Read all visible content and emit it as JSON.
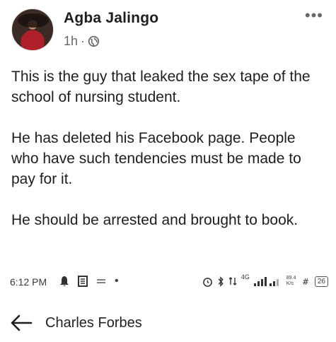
{
  "post": {
    "author": "Agba Jalingo",
    "time": "1h",
    "separator": "·",
    "paragraphs": [
      "This is the guy that leaked the sex tape of the school of nursing student.",
      "He has deleted his Facebook page. People who have such tendencies must be made to pay for it.",
      "He should be arrested and brought to book."
    ],
    "more_icon": "more-horizontal-icon",
    "privacy_icon": "globe-icon"
  },
  "status_bar": {
    "time": "6:12 PM",
    "speed": "89.4 K/s",
    "network": "4G",
    "battery": "26"
  },
  "nav": {
    "back_icon": "arrow-left-icon",
    "title": "Charles Forbes"
  }
}
